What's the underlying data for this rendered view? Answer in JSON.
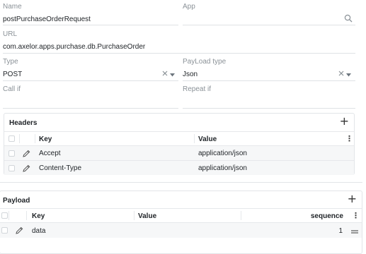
{
  "form": {
    "name": {
      "label": "Name",
      "value": "postPurchaseOrderRequest"
    },
    "app": {
      "label": "App",
      "value": ""
    },
    "url": {
      "label": "URL",
      "value": "com.axelor.apps.purchase.db.PurchaseOrder"
    },
    "type": {
      "label": "Type",
      "value": "POST"
    },
    "payload_type": {
      "label": "PayLoad type",
      "value": "Json"
    },
    "call_if": {
      "label": "Call if",
      "value": ""
    },
    "repeat_if": {
      "label": "Repeat if",
      "value": ""
    }
  },
  "headers": {
    "title": "Headers",
    "add_label": "+",
    "columns": {
      "key": "Key",
      "value": "Value"
    },
    "rows": [
      {
        "key": "Accept",
        "value": "application/json"
      },
      {
        "key": "Content-Type",
        "value": "application/json"
      }
    ]
  },
  "payload": {
    "title": "Payload",
    "add_label": "+",
    "columns": {
      "key": "Key",
      "value": "Value",
      "sequence": "sequence"
    },
    "rows": [
      {
        "key": "data",
        "value": "",
        "sequence": "1"
      }
    ]
  },
  "icons": {
    "search": "search-icon",
    "clear": "close-icon",
    "dropdown": "chevron-down-icon",
    "edit": "pencil-icon",
    "menu": "kebab-menu-icon",
    "drag": "drag-handle-icon"
  }
}
